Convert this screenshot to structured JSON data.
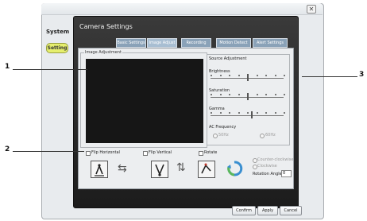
{
  "system_menu": {
    "title": "System",
    "setting_label": "Setting"
  },
  "window": {
    "close_glyph": "✕"
  },
  "camera_settings": {
    "title": "Camera Settings",
    "tabs": [
      "Basic Settings",
      "Image Adjust",
      "Recording",
      "Motion Detect",
      "Alert Settings"
    ],
    "active_tab_index": 1
  },
  "image_adjustment": {
    "label": "Image Adjustment"
  },
  "source_adjustment": {
    "label": "Source Adjustment",
    "sliders": [
      {
        "label": "Brightness",
        "level": 0.5
      },
      {
        "label": "Saturation",
        "level": 0.5
      },
      {
        "label": "Gamma",
        "level": 0.55
      }
    ],
    "ac_frequency": {
      "label": "AC Frequency",
      "options": [
        "50Hz",
        "60Hz"
      ]
    }
  },
  "checkboxes": {
    "flip_horizontal": "Flip Horizontal",
    "flip_vertical": "Flip Vertical",
    "rotate": "Rotate"
  },
  "rotate_options": {
    "option_1": "Counter-clockwise",
    "option_2": "Clockwise",
    "rotation_angle_label": "Rotation Angle",
    "rotation_angle_value": "0"
  },
  "buttons": {
    "confirm": "Confirm",
    "apply": "Apply",
    "cancel": "Cancel"
  },
  "callouts": {
    "c1": "1",
    "c2": "2",
    "c3": "3"
  }
}
